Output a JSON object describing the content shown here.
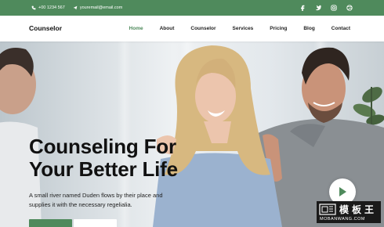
{
  "topbar": {
    "phone": "+00 1234 567",
    "email": "youremail@email.com",
    "social_icons": [
      "facebook-icon",
      "twitter-icon",
      "instagram-icon",
      "dribbble-icon"
    ]
  },
  "nav": {
    "brand": "Counselor",
    "items": [
      {
        "label": "Home",
        "active": true
      },
      {
        "label": "About"
      },
      {
        "label": "Counselor"
      },
      {
        "label": "Services"
      },
      {
        "label": "Pricing"
      },
      {
        "label": "Blog"
      },
      {
        "label": "Contact"
      }
    ]
  },
  "hero": {
    "headline_line1": "Counseling For",
    "headline_line2": "Your Better Life",
    "description": "A small river named Duden flows by their place and supplies it with the necessary regelialia."
  },
  "watermark": {
    "cn": "模板王",
    "en": "MOBANWANG.COM"
  },
  "colors": {
    "accent": "#4f8a5c",
    "text": "#111111"
  }
}
